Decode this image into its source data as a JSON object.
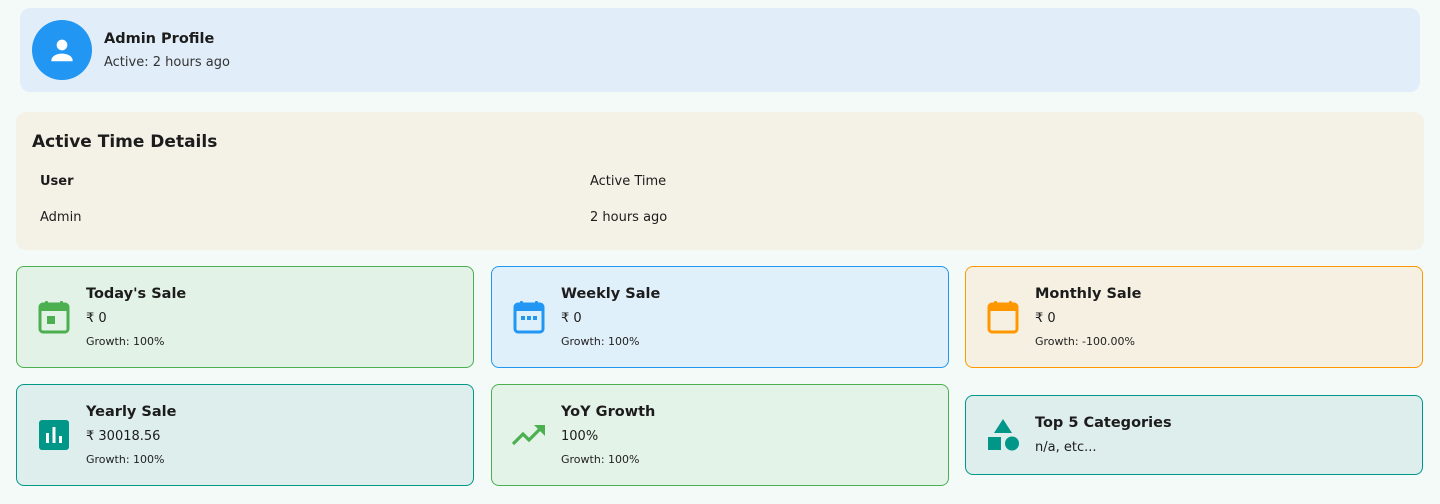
{
  "profile": {
    "name": "Admin Profile",
    "status": "Active: 2 hours ago",
    "avatar_icon": "person-icon",
    "avatar_color": "#2196f3"
  },
  "active_time": {
    "title": "Active Time Details",
    "columns": [
      "User",
      "Active Time"
    ],
    "rows": [
      [
        "Admin",
        "2 hours ago"
      ]
    ]
  },
  "cards": {
    "today": {
      "title": "Today's Sale",
      "value": "₹ 0",
      "growth": "Growth: 100%",
      "icon": "calendar-today-icon",
      "color": "#4caf50"
    },
    "weekly": {
      "title": "Weekly Sale",
      "value": "₹ 0",
      "growth": "Growth: 100%",
      "icon": "calendar-week-icon",
      "color": "#2196f3"
    },
    "monthly": {
      "title": "Monthly Sale",
      "value": "₹ 0",
      "growth": "Growth: -100.00%",
      "icon": "calendar-month-icon",
      "color": "#ff9800"
    },
    "yearly": {
      "title": "Yearly Sale",
      "value": "₹ 30018.56",
      "growth": "Growth: 100%",
      "icon": "bar-chart-icon",
      "color": "#009688"
    },
    "yoy": {
      "title": "YoY Growth",
      "value": "100%",
      "growth": "Growth: 100%",
      "icon": "trending-up-icon",
      "color": "#4caf50"
    },
    "categories": {
      "title": "Top 5 Categories",
      "value": "n/a, etc...",
      "icon": "category-shapes-icon",
      "color": "#009688"
    }
  }
}
